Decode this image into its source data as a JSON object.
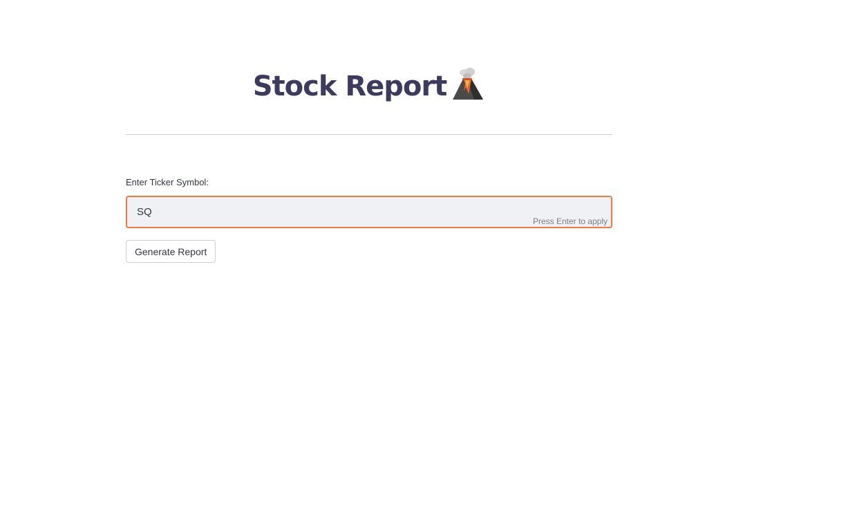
{
  "header": {
    "title": "Stock Report",
    "title_icon": "volcano-icon"
  },
  "form": {
    "ticker_label": "Enter Ticker Symbol:",
    "ticker_value": "SQ",
    "ticker_hint": "Press Enter to apply",
    "submit_label": "Generate Report"
  },
  "colors": {
    "title": "#3c3a5f",
    "input_focus_border": "#f0783d",
    "input_background": "#eff1f5"
  }
}
